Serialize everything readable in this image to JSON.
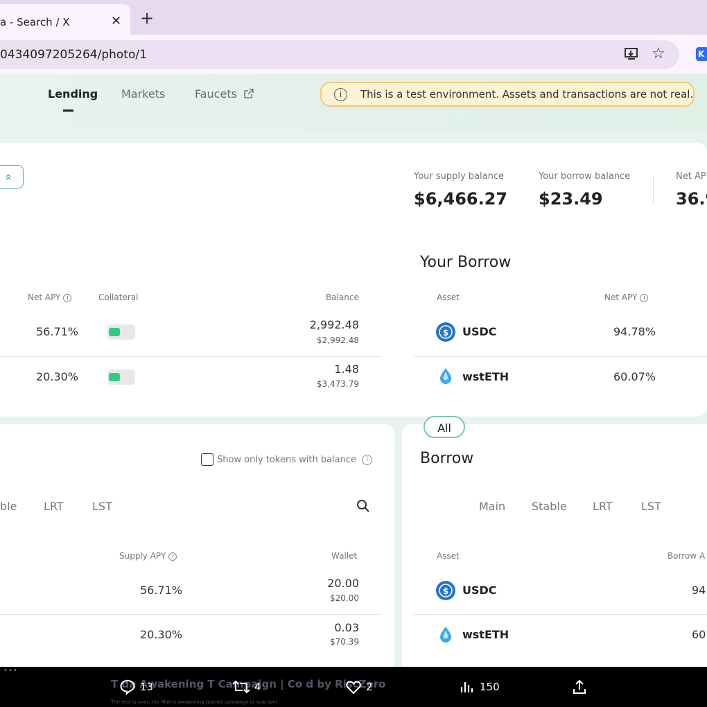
{
  "browser": {
    "tab_title": "a - Search / X",
    "tab_close": "✕",
    "new_tab": "+",
    "url": "0434097205264/photo/1",
    "install_icon": "install-icon",
    "bookmark_icon": "☆",
    "extension_label": "K"
  },
  "nav": {
    "items": [
      {
        "label": "Lending",
        "active": true
      },
      {
        "label": "Markets",
        "active": false
      },
      {
        "label": "Faucets",
        "active": false
      }
    ],
    "banner_text": "This is a test environment. Assets and transactions are not real."
  },
  "summary": {
    "supply_label": "Your supply balance",
    "supply_value": "$6,466.27",
    "borrow_label": "Your borrow balance",
    "borrow_value": "$23.49",
    "net_apy_label": "Net AP",
    "net_apy_value": "36.9"
  },
  "your_supplies": {
    "headers": {
      "net_apy": "Net APY",
      "collateral": "Collateral",
      "balance": "Balance"
    },
    "rows": [
      {
        "net_apy": "56.71%",
        "collateral": true,
        "balance": "2,992.48",
        "balance_usd": "$2,992.48"
      },
      {
        "net_apy": "20.30%",
        "collateral": true,
        "balance": "1.48",
        "balance_usd": "$3,473.79"
      }
    ]
  },
  "your_borrow": {
    "title": "Your Borrow",
    "headers": {
      "asset": "Asset",
      "net_apy": "Net APY"
    },
    "rows": [
      {
        "asset": "USDC",
        "net_apy": "94.78%"
      },
      {
        "asset": "wstETH",
        "net_apy": "60.07%"
      }
    ]
  },
  "supply": {
    "show_only_label": "Show only tokens with balance",
    "tabs": [
      "ble",
      "LRT",
      "LST"
    ],
    "headers": {
      "supply_apy": "Supply APY",
      "wallet": "Wallet"
    },
    "rows": [
      {
        "supply_apy": "56.71%",
        "wallet": "20.00",
        "wallet_usd": "$20.00"
      },
      {
        "supply_apy": "20.30%",
        "wallet": "0.03",
        "wallet_usd": "$70.39"
      }
    ]
  },
  "borrow": {
    "title": "Borrow",
    "tabs": [
      "All",
      "Main",
      "Stable",
      "LRT",
      "LST"
    ],
    "headers": {
      "asset": "Asset",
      "borrow_apy": "Borrow A"
    },
    "rows": [
      {
        "asset": "USDC",
        "borrow_apy": "94."
      },
      {
        "asset": "wstETH",
        "borrow_apy": "60."
      }
    ]
  },
  "tweet": {
    "caption": "T       da Awakening T     Campaign | Co        d by RiscZero",
    "subcaption": "The rest is over, the Matrix Awakening testnet campaign is now live!",
    "replies": "13",
    "retweets": "4",
    "likes": "2",
    "views": "150"
  },
  "colors": {
    "accent": "#2fce7e",
    "usdc": "#2775ca",
    "wsteth": "#3ca8f0",
    "banner_bg": "#fdf2d4"
  }
}
